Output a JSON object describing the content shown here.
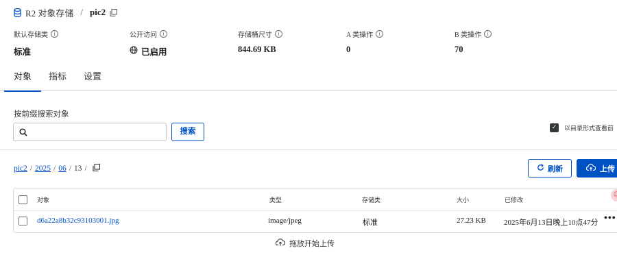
{
  "header": {
    "service_name": "R2 对象存储",
    "separator": "/",
    "bucket_name": "pic2"
  },
  "stats": [
    {
      "label": "默认存储类",
      "value": "标准"
    },
    {
      "label": "公开访问",
      "value": "已启用"
    },
    {
      "label": "存储桶尺寸",
      "value": "844.69 KB"
    },
    {
      "label": "A 类操作",
      "value": "0"
    },
    {
      "label": "B 类操作",
      "value": "70"
    }
  ],
  "tabs": [
    {
      "label": "对象",
      "active": true
    },
    {
      "label": "指标",
      "active": false
    },
    {
      "label": "设置",
      "active": false
    }
  ],
  "search": {
    "label": "按前缀搜索对象",
    "value": "",
    "placeholder": "",
    "button_label": "搜索"
  },
  "directory_view": {
    "label": "以目录形式查看前",
    "checked": true
  },
  "path": {
    "segments": [
      "pic2",
      "2025",
      "06",
      "13"
    ]
  },
  "actions": {
    "refresh_label": "刷新",
    "upload_label": "上传"
  },
  "table": {
    "columns": [
      "对象",
      "类型",
      "存储类",
      "大小",
      "已修改"
    ],
    "rows": [
      {
        "name": "d6a22a8b32c93103001.jpg",
        "type": "image/jpeg",
        "storage_class": "标准",
        "size": "27.23 KB",
        "modified": "2025年6月13日晚上10点47分",
        "more": "•••"
      }
    ]
  },
  "dropzone": {
    "label": "拖放开始上传"
  },
  "colors": {
    "accent": "#0051c3",
    "text": "#1d1f20",
    "border": "#d9d9d9"
  }
}
